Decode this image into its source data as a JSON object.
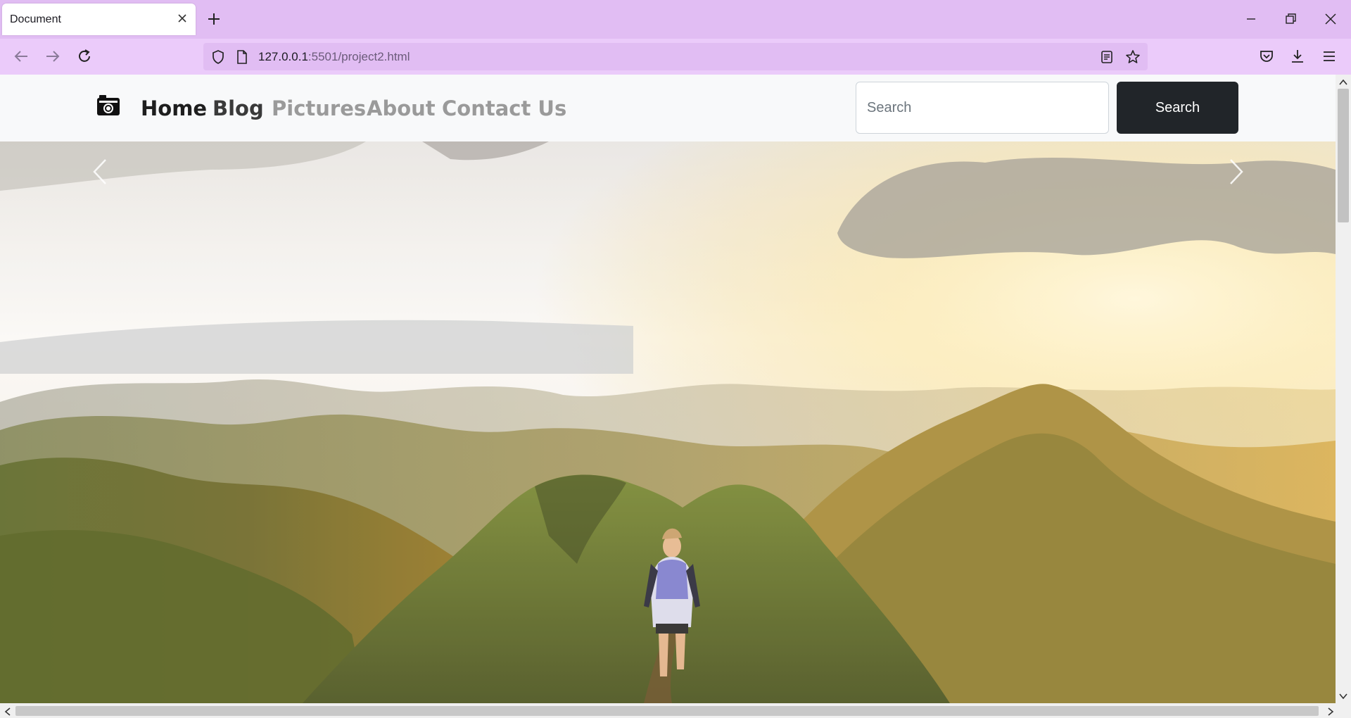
{
  "browser": {
    "tab_title": "Document",
    "url_host": "127.0.0.1",
    "url_rest": ":5501/project2.html"
  },
  "site": {
    "nav": [
      "Home",
      "Blog",
      "Pictures",
      "About",
      "Contact Us"
    ],
    "search_placeholder": "Search",
    "search_button": "Search"
  },
  "colors": {
    "tabbar": "#e1bdf3",
    "toolbar": "#ebcbfa",
    "search_button": "#212529"
  }
}
